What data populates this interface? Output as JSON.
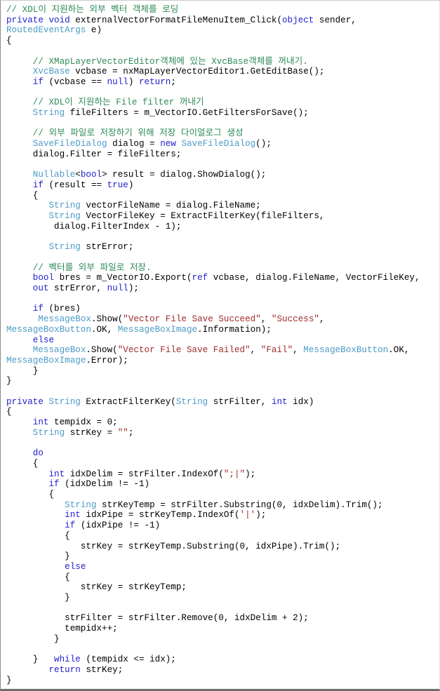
{
  "window": {
    "kind": "code-snippet",
    "language": "C#",
    "background_color": "#ffffff",
    "border_color": "#8a8a8a"
  },
  "theme": {
    "comment_color": "#2E8B57",
    "keyword_color": "#2222CC",
    "type_color": "#4D9AC6",
    "string_color": "#9E2B2B",
    "plain_color": "#000000"
  },
  "code": {
    "lines": [
      "// XDL이 지원하는 외부 벡터 객체를 로딩",
      "private void externalVectorFormatFileMenuItem_Click(object sender,",
      "RoutedEventArgs e)",
      "{",
      "",
      "     // XMapLayerVectorEditor객체에 있는 XvcBase객체를 꺼내기.",
      "     XvcBase vcbase = nxMapLayerVectorEditor1.GetEditBase();",
      "     if (vcbase == null) return;",
      "",
      "     // XDL이 지원하는 File filter 꺼내기",
      "     String fileFilters = m_VectorIO.GetFiltersForSave();",
      "",
      "     // 외부 파일로 저장하기 위해 저장 다이얼로그 생성",
      "     SaveFileDialog dialog = new SaveFileDialog();",
      "     dialog.Filter = fileFilters;",
      "",
      "     Nullable<bool> result = dialog.ShowDialog();",
      "     if (result == true)",
      "     {",
      "        String vectorFileName = dialog.FileName;",
      "        String VectorFileKey = ExtractFilterKey(fileFilters,",
      "         dialog.FilterIndex - 1);",
      "",
      "        String strError;",
      "",
      "     // 벡터를 외부 파일로 저장.",
      "     bool bres = m_VectorIO.Export(ref vcbase, dialog.FileName, VectorFileKey,",
      "     out strError, null);",
      "",
      "     if (bres)",
      "      MessageBox.Show(\"Vector File Save Succeed\", \"Success\",",
      "MessageBoxButton.OK, MessageBoxImage.Information);",
      "     else",
      "     MessageBox.Show(\"Vector File Save Failed\", \"Fail\", MessageBoxButton.OK,",
      "MessageBoxImage.Error);",
      "     }",
      "}",
      "",
      "private String ExtractFilterKey(String strFilter, int idx)",
      "{",
      "     int tempidx = 0;",
      "     String strKey = \"\";",
      "",
      "     do",
      "     {",
      "        int idxDelim = strFilter.IndexOf(\";|\");",
      "        if (idxDelim != -1)",
      "        {",
      "           String strKeyTemp = strFilter.Substring(0, idxDelim).Trim();",
      "           int idxPipe = strKeyTemp.IndexOf('|');",
      "           if (idxPipe != -1)",
      "           {",
      "              strKey = strKeyTemp.Substring(0, idxPipe).Trim();",
      "           }",
      "           else",
      "           {",
      "              strKey = strKeyTemp;",
      "           }",
      "",
      "           strFilter = strFilter.Remove(0, idxDelim + 2);",
      "           tempidx++;",
      "         }",
      "",
      "     }   while (tempidx <= idx);",
      "        return strKey;",
      "}"
    ],
    "tokens": {
      "keywords": [
        "private",
        "void",
        "if",
        "return",
        "new",
        "else",
        "bool",
        "int",
        "do",
        "while",
        "out",
        "ref",
        "null",
        "true",
        "object"
      ],
      "types": [
        "RoutedEventArgs",
        "XvcBase",
        "String",
        "SaveFileDialog",
        "Nullable",
        "MessageBox",
        "MessageBoxButton",
        "MessageBoxImage"
      ],
      "strings": [
        "\"Vector File Save Succeed\"",
        "\"Success\"",
        "\"Vector File Save Failed\"",
        "\"Fail\"",
        "\"\"",
        "\";|\"",
        "'|'"
      ]
    }
  }
}
